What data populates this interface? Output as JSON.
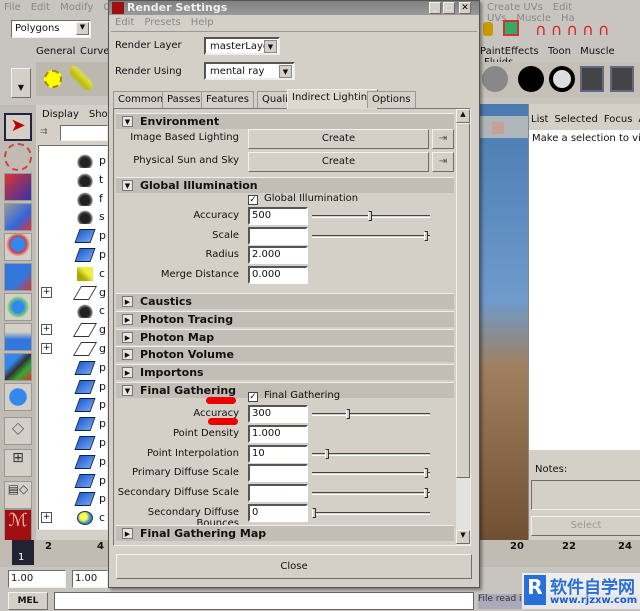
{
  "main_menu": [
    "File",
    "Edit",
    "Modify",
    "Cre"
  ],
  "right_menu": [
    "Create UVs",
    "Edit UVs",
    "Muscle",
    "Ha"
  ],
  "mode_select": "Polygons",
  "shelf_tabs_left": [
    "General",
    "Curve"
  ],
  "shelf_tabs_right": [
    "PaintEffects",
    "Toon",
    "Muscle",
    "Fluids"
  ],
  "outliner": {
    "menu": [
      "Display",
      "Show"
    ],
    "items": [
      {
        "icon": "camera",
        "label": "p"
      },
      {
        "icon": "camera",
        "label": "t"
      },
      {
        "icon": "camera",
        "label": "f"
      },
      {
        "icon": "camera",
        "label": "s"
      },
      {
        "icon": "mesh",
        "label": "p"
      },
      {
        "icon": "mesh",
        "label": "p"
      },
      {
        "icon": "light",
        "label": "c"
      },
      {
        "icon": "plane",
        "label": "g",
        "expand": true
      },
      {
        "icon": "camera",
        "label": "c"
      },
      {
        "icon": "plane",
        "label": "g",
        "expand": true
      },
      {
        "icon": "plane",
        "label": "g",
        "expand": true
      },
      {
        "icon": "mesh",
        "label": "p"
      },
      {
        "icon": "mesh",
        "label": "p"
      },
      {
        "icon": "mesh",
        "label": "p"
      },
      {
        "icon": "mesh",
        "label": "p"
      },
      {
        "icon": "mesh",
        "label": "p"
      },
      {
        "icon": "mesh",
        "label": "p"
      },
      {
        "icon": "mesh",
        "label": "p"
      },
      {
        "icon": "mesh",
        "label": "p"
      },
      {
        "icon": "sphere",
        "label": "c",
        "expand": true
      }
    ]
  },
  "attr_panel": {
    "menu": [
      "List",
      "Selected",
      "Focus",
      "At"
    ],
    "message": "Make a selection to view a",
    "notes_label": "Notes:",
    "select_button": "Select"
  },
  "dialog": {
    "title": "Render Settings",
    "menu": [
      "Edit",
      "Presets",
      "Help"
    ],
    "render_layer_label": "Render Layer",
    "render_layer": "masterLayer",
    "render_using_label": "Render Using",
    "render_using": "mental ray",
    "tabs": [
      "Common",
      "Passes",
      "Features",
      "Quality",
      "Indirect Lighting",
      "Options"
    ],
    "active_tab": "Indirect Lighting",
    "environment": {
      "title": "Environment",
      "rows": [
        {
          "label": "Image Based Lighting",
          "button": "Create"
        },
        {
          "label": "Physical Sun and Sky",
          "button": "Create"
        }
      ]
    },
    "gi": {
      "title": "Global Illumination",
      "checkbox": "Global Illumination",
      "checked": true,
      "rows": [
        {
          "label": "Accuracy",
          "value": "500",
          "slider": 0.5
        },
        {
          "label": "Scale",
          "value": "",
          "slider": 1.0
        },
        {
          "label": "Radius",
          "value": "2.000"
        },
        {
          "label": "Merge Distance",
          "value": "0.000"
        }
      ]
    },
    "collapsed": [
      "Caustics",
      "Photon Tracing",
      "Photon Map",
      "Photon Volume",
      "Importons"
    ],
    "fg": {
      "title": "Final Gathering",
      "checkbox": "Final Gathering",
      "checked": true,
      "rows": [
        {
          "label": "Accuracy",
          "value": "300",
          "slider": 0.3
        },
        {
          "label": "Point Density",
          "value": "1.000"
        },
        {
          "label": "Point Interpolation",
          "value": "10",
          "slider": 0.12
        },
        {
          "label": "Primary Diffuse Scale",
          "value": "",
          "slider": 1.0
        },
        {
          "label": "Secondary Diffuse Scale",
          "value": "",
          "slider": 1.0
        },
        {
          "label": "Secondary Diffuse Bounces",
          "value": "0",
          "slider": 0.0
        }
      ]
    },
    "fg_map": "Final Gathering Map",
    "close": "Close"
  },
  "timeline": {
    "left_ticks": [
      "2",
      "4"
    ],
    "right_ticks": [
      "20",
      "22",
      "24"
    ],
    "current": "1"
  },
  "range": {
    "start": "1.00",
    "start2": "1.00"
  },
  "command_line": {
    "label": "MEL",
    "status": "File read i"
  },
  "watermark": {
    "cn": "软件自学网",
    "url": "www.rjzxw.com"
  }
}
